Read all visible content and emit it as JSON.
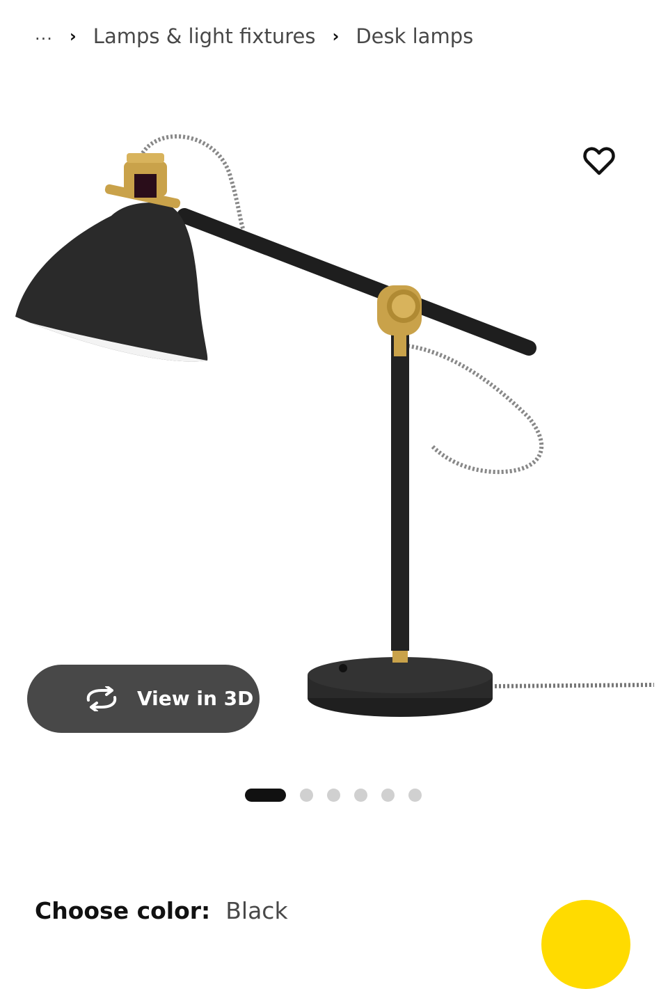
{
  "breadcrumb": {
    "ellipsis": "...",
    "separator": "›",
    "items": [
      "Lamps & light fixtures",
      "Desk lamps"
    ]
  },
  "icons": {
    "favorite": "heart-outline-icon",
    "view3d": "rotate-3d-icon"
  },
  "gallery": {
    "view3d_label": "View in 3D",
    "total_images": 6,
    "active_index": 0
  },
  "color": {
    "label": "Choose color:",
    "value": "Black"
  },
  "colors": {
    "button_dark": "#484848",
    "accent_yellow": "#ffdb00",
    "lamp_black": "#222222",
    "brass": "#c9a24a"
  }
}
